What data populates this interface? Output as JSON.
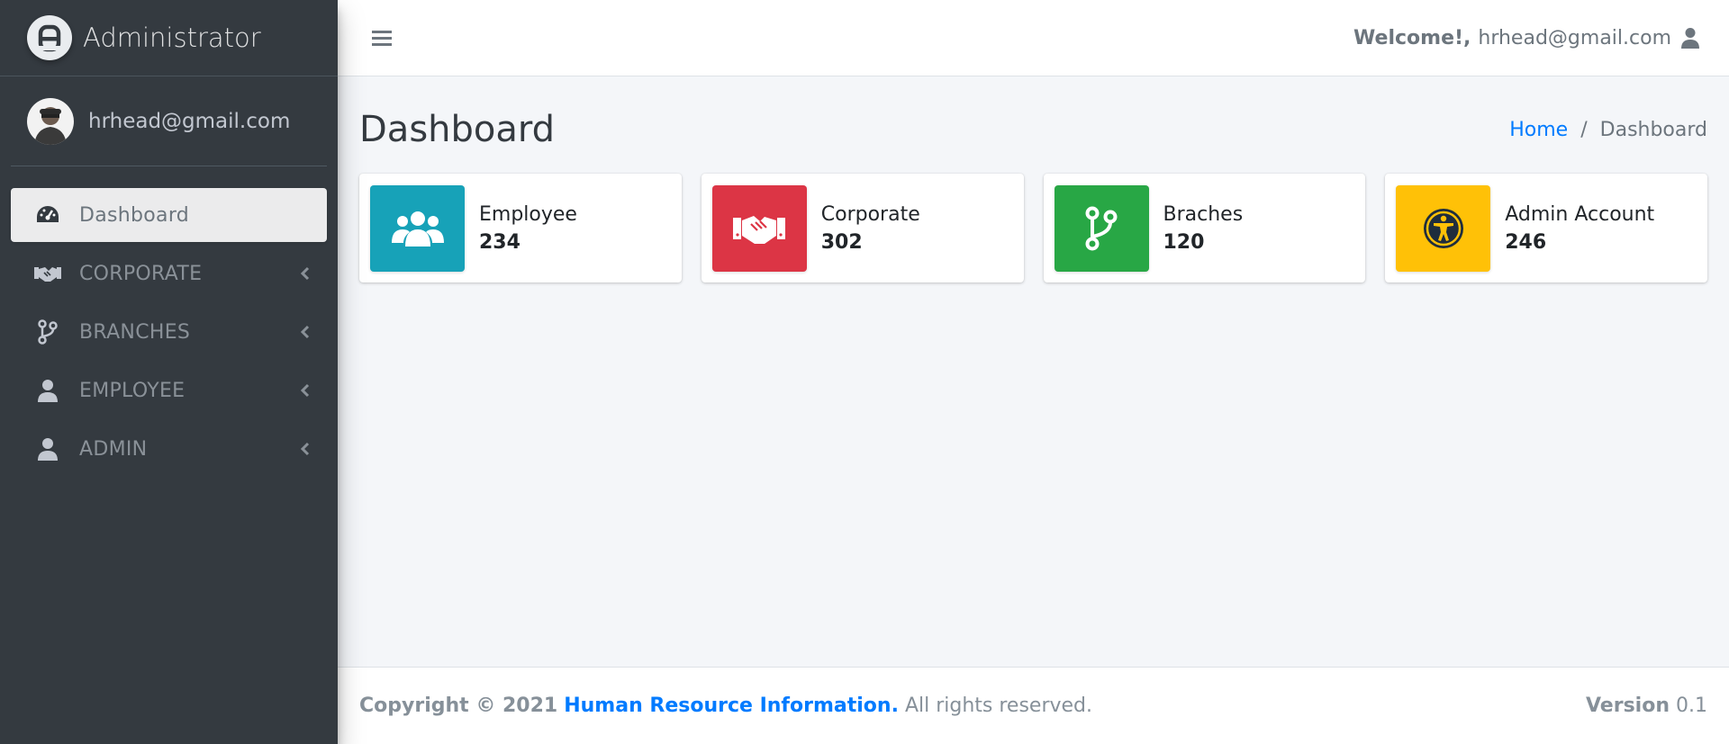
{
  "brand": {
    "title": "Administrator"
  },
  "user": {
    "email": "hrhead@gmail.com"
  },
  "sidebar": {
    "items": [
      {
        "label": "Dashboard",
        "icon": "tachometer-icon"
      },
      {
        "label": "CORPORATE",
        "icon": "handshake-icon"
      },
      {
        "label": "BRANCHES",
        "icon": "code-branch-icon"
      },
      {
        "label": "EMPLOYEE",
        "icon": "user-icon"
      },
      {
        "label": "ADMIN",
        "icon": "user-icon"
      }
    ]
  },
  "topbar": {
    "welcome": "Welcome!,",
    "email": "hrhead@gmail.com"
  },
  "page": {
    "title": "Dashboard",
    "breadcrumb": {
      "home": "Home",
      "separator": "/",
      "current": "Dashboard"
    }
  },
  "cards": [
    {
      "label": "Employee",
      "value": "234",
      "color": "#17a2b8",
      "icon": "users-icon"
    },
    {
      "label": "Corporate",
      "value": "302",
      "color": "#dc3545",
      "icon": "handshake-icon"
    },
    {
      "label": "Braches",
      "value": "120",
      "color": "#28a745",
      "icon": "code-branch-icon"
    },
    {
      "label": "Admin Account",
      "value": "246",
      "color": "#ffc107",
      "icon": "universal-access-icon"
    }
  ],
  "footer": {
    "copyright": "Copyright © 2021",
    "company": "Human Resource Information.",
    "rights": "All rights reserved.",
    "version_label": "Version",
    "version": "0.1"
  }
}
